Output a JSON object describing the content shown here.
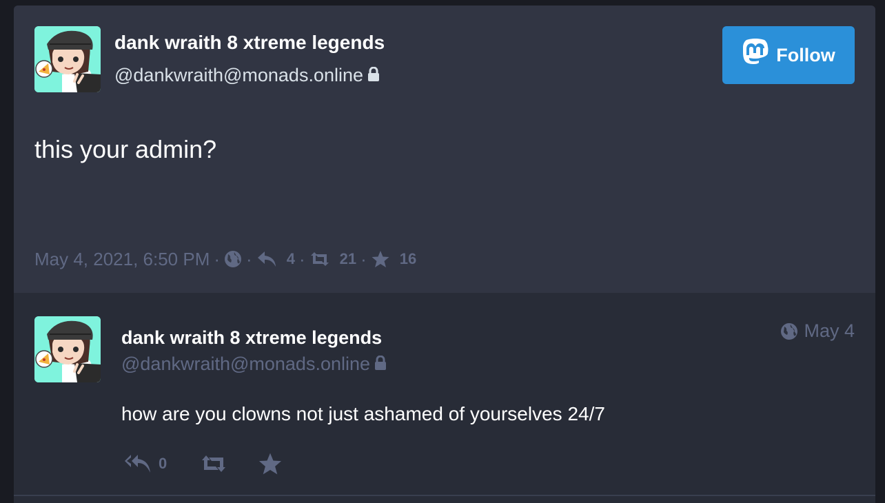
{
  "main_status": {
    "author": {
      "display_name": "dank wraith 8 xtreme legends",
      "handle": "@dankwraith@monads.online",
      "avatar": "anime-avatar-pizza",
      "locked_icon": "lock-icon"
    },
    "follow_button": {
      "label": "Follow",
      "icon": "mastodon-logo-icon"
    },
    "content": "this your admin?",
    "meta": {
      "timestamp": "May 4, 2021, 6:50 PM",
      "separator": "·",
      "visibility_icon": "globe-icon",
      "replies": "4",
      "boosts": "21",
      "favourites": "16"
    }
  },
  "reply_status": {
    "author": {
      "display_name": "dank wraith 8 xtreme legends",
      "handle": "@dankwraith@monads.online",
      "avatar": "anime-avatar-pizza",
      "locked_icon": "lock-icon"
    },
    "relative_time": "May 4",
    "visibility_icon": "globe-icon",
    "content": "how are you clowns not just ashamed of yourselves 24/7",
    "actions": {
      "replies": "0"
    }
  },
  "colors": {
    "page_bg": "#191b22",
    "main_status_bg": "#313543",
    "reply_bg": "#282c37",
    "accent": "#2b90d9",
    "muted": "#606984",
    "handle_main": "#d9e1e8",
    "avatar_bg": "#7ff3dd"
  }
}
